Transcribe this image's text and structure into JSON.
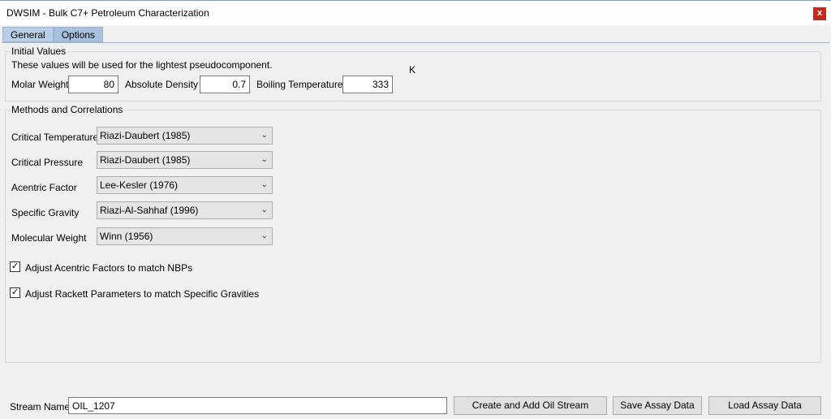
{
  "window": {
    "title": "DWSIM - Bulk C7+ Petroleum Characterization",
    "close_label": "x"
  },
  "tabs": [
    {
      "label": "General"
    },
    {
      "label": "Options"
    }
  ],
  "initial_values": {
    "title": "Initial Values",
    "description": "These values will be used for the lightest pseudocomponent.",
    "unit": "K",
    "molar_weight": {
      "label": "Molar Weight",
      "value": "80"
    },
    "absolute_density": {
      "label": "Absolute Density",
      "value": "0.7"
    },
    "boiling_temperature": {
      "label": "Boiling Temperature",
      "value": "333"
    }
  },
  "methods": {
    "title": "Methods and Correlations",
    "rows": [
      {
        "label": "Critical Temperature",
        "value": "Riazi-Daubert (1985)"
      },
      {
        "label": "Critical Pressure",
        "value": "Riazi-Daubert (1985)"
      },
      {
        "label": "Acentric Factor",
        "value": "Lee-Kesler (1976)"
      },
      {
        "label": "Specific Gravity",
        "value": "Riazi-Al-Sahhaf (1996)"
      },
      {
        "label": "Molecular Weight",
        "value": "Winn (1956)"
      }
    ],
    "checkboxes": [
      {
        "label": "Adjust Acentric Factors to match NBPs",
        "checked": true,
        "mark": "✓"
      },
      {
        "label": "Adjust Rackett Parameters to match Specific Gravities",
        "checked": true,
        "mark": "✓"
      }
    ]
  },
  "footer": {
    "stream_name_label": "Stream Name",
    "stream_name_value": "OIL_1207",
    "create_button": "Create and Add Oil Stream",
    "save_button": "Save Assay Data",
    "load_button": "Load Assay Data"
  }
}
